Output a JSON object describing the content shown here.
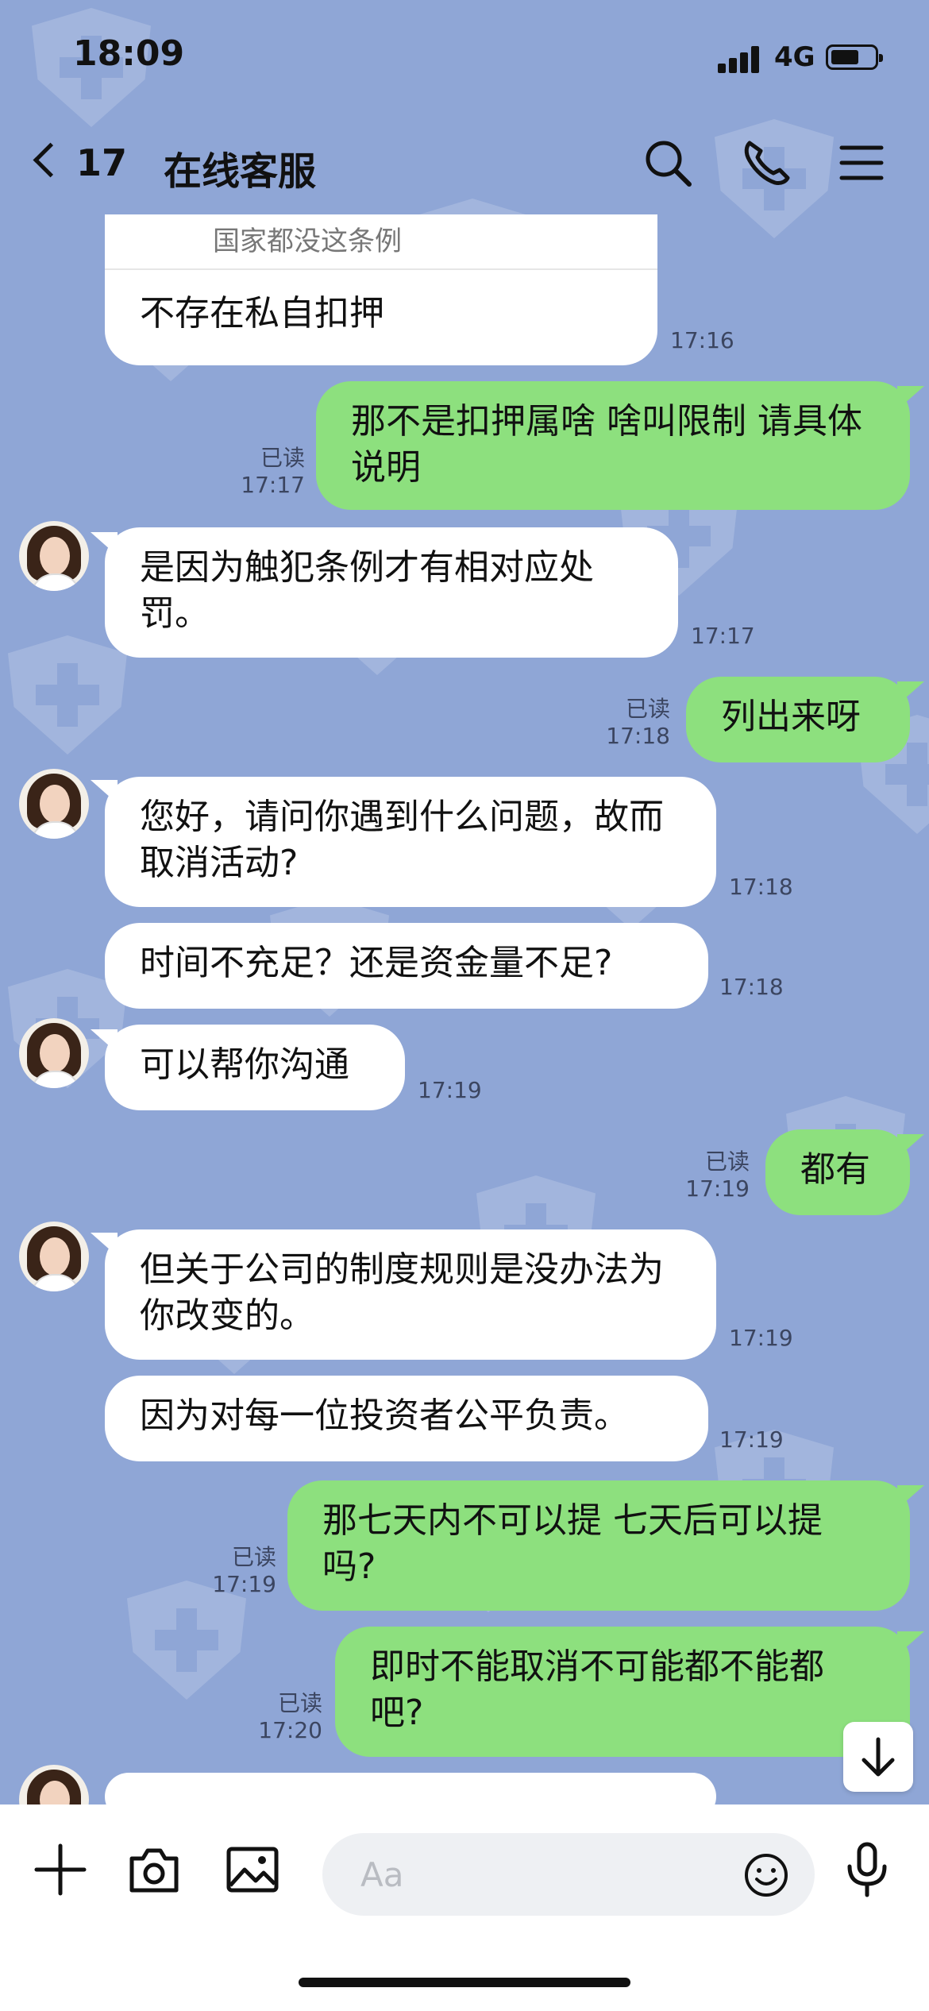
{
  "status_bar": {
    "time": "18:09",
    "network": "4G"
  },
  "header": {
    "back_count": "17",
    "title": "在线客服"
  },
  "quoted": {
    "text": "国家都没这条例"
  },
  "messages": [
    {
      "side": "in",
      "text": "不存在私自扣押",
      "time": "17:16"
    },
    {
      "side": "out",
      "text": "那不是扣押属啥 啥叫限制 请具体说明",
      "read": "已读",
      "time": "17:17"
    },
    {
      "side": "in",
      "text": "是因为触犯条例才有相对应处罚。",
      "time": "17:17"
    },
    {
      "side": "out",
      "text": "列出来呀",
      "read": "已读",
      "time": "17:18"
    },
    {
      "side": "in",
      "text": "您好，请问你遇到什么问题，故而取消活动?",
      "time": "17:18"
    },
    {
      "side": "in",
      "text": "时间不充足？还是资金量不足?",
      "time": "17:18"
    },
    {
      "side": "in",
      "text": "可以帮你沟通",
      "time": "17:19"
    },
    {
      "side": "out",
      "text": "都有",
      "read": "已读",
      "time": "17:19"
    },
    {
      "side": "in",
      "text": "但关于公司的制度规则是没办法为你改变的。",
      "time": "17:19"
    },
    {
      "side": "in",
      "text": "因为对每一位投资者公平负责。",
      "time": "17:19"
    },
    {
      "side": "out",
      "text": "那七天内不可以提 七天后可以提吗?",
      "read": "已读",
      "time": "17:19"
    },
    {
      "side": "out",
      "text": "即时不能取消不可能都不能都吧?",
      "read": "已读",
      "time": "17:20"
    }
  ],
  "input": {
    "placeholder": "Aa"
  },
  "icons": [
    "back-chevron-icon",
    "search-icon",
    "phone-icon",
    "menu-icon",
    "plus-icon",
    "camera-icon",
    "image-icon",
    "emoji-icon",
    "microphone-icon",
    "scroll-down-icon"
  ],
  "colors": {
    "background": "#8fa6d6",
    "incoming": "#ffffff",
    "outgoing": "#8de07e"
  }
}
